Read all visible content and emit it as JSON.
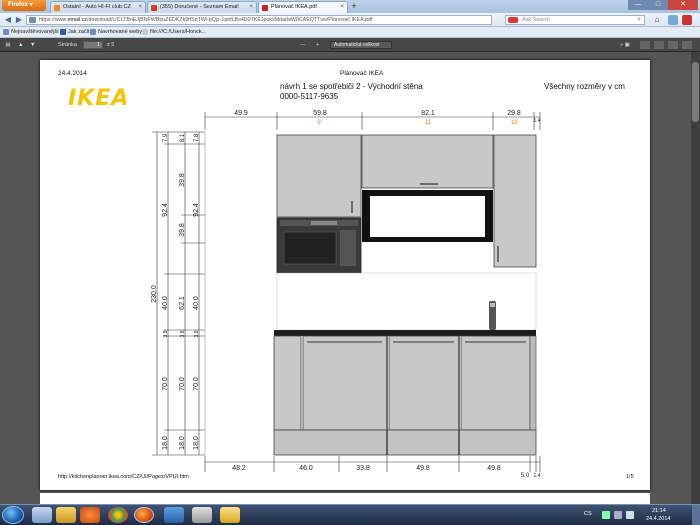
{
  "browser": {
    "menu_label": "Firefox ▾",
    "tabs": [
      {
        "label": "Ostatní - Auto HI-FI club CZ",
        "color": "#f08a24"
      },
      {
        "label": "(355) Doručené - Seznam Email",
        "color": "#d43a2a"
      },
      {
        "label": "Plánovač IKEA.pdf",
        "color": "#cc2222"
      }
    ],
    "tab_close": "×",
    "new_tab": "+",
    "window_buttons": [
      "—",
      "□",
      "✕"
    ],
    "url_prefix": "https://www.",
    "url_domain": "email.cz",
    "url_rest": "/download/c/CLTBnEJjBNFWBbuZEDKZk9tfSqTWi-pQjz-1pbfLBs4D0TKEJpoksMdadaW0CAEQTTvw/Plánovač IKEA.pdf",
    "search_placeholder": "Ask Search",
    "nav_back": "◀",
    "nav_forward": "▶",
    "search_icon": "⌕",
    "home_icon": "⌂",
    "bookmarks": [
      {
        "label": "Nejnavštěvovanější",
        "color": "#6b8ebf"
      },
      {
        "label": "Jak začít",
        "color": "#2a5aa8"
      },
      {
        "label": "Navrhované weby",
        "color": "#6b8ebf"
      },
      {
        "label": "file:///C:/Users/Honck...",
        "color": "#c9c9c9"
      }
    ]
  },
  "pdf_toolbar": {
    "up": "▲",
    "down": "▼",
    "page_label": "Stránka",
    "page_value": "1",
    "page_total": "z 5",
    "zoom_out": "—",
    "zoom_in": "+",
    "zoom_value": "Automatická velikost",
    "tools": "» ▣"
  },
  "document": {
    "date": "24.4.2014",
    "center_title": "Plánovač IKEA",
    "logo": "IKEA",
    "plan_title": "návrh 1 se spotřebiči 2 - Východní stěna",
    "plan_code": "0000-5117-9635",
    "units_note": "Všechny rozměry v cm",
    "footer_url": "http://kitchenplanner.ikea.com/CZ/UI/Pages/VPUI.htm",
    "footer_page": "1/5",
    "top_dims": [
      "49.9",
      "59.8",
      "82.1",
      "29.8",
      "1.4"
    ],
    "top_markers": [
      "9",
      "11",
      "12"
    ],
    "bottom_dims": [
      "48.2",
      "46.0",
      "33.8",
      "49.8",
      "49.8",
      "5.0",
      "1.4"
    ],
    "left_total": "230.0",
    "left_col2": [
      "7.9",
      "92.4",
      "40.0",
      "3.8",
      "70.0",
      "18.0"
    ],
    "left_col3": [
      "8.1",
      "39.8",
      "39.8",
      "62.1",
      "3.8",
      "70.0",
      "18.0"
    ],
    "left_col4": [
      "7.8",
      "92.4",
      "40.0",
      "3.8",
      "70.0",
      "18.0"
    ],
    "wall_markers": [
      "3",
      "4",
      "5"
    ]
  },
  "taskbar": {
    "language": "CS",
    "time": "21:14",
    "date": "24.4.2014"
  }
}
